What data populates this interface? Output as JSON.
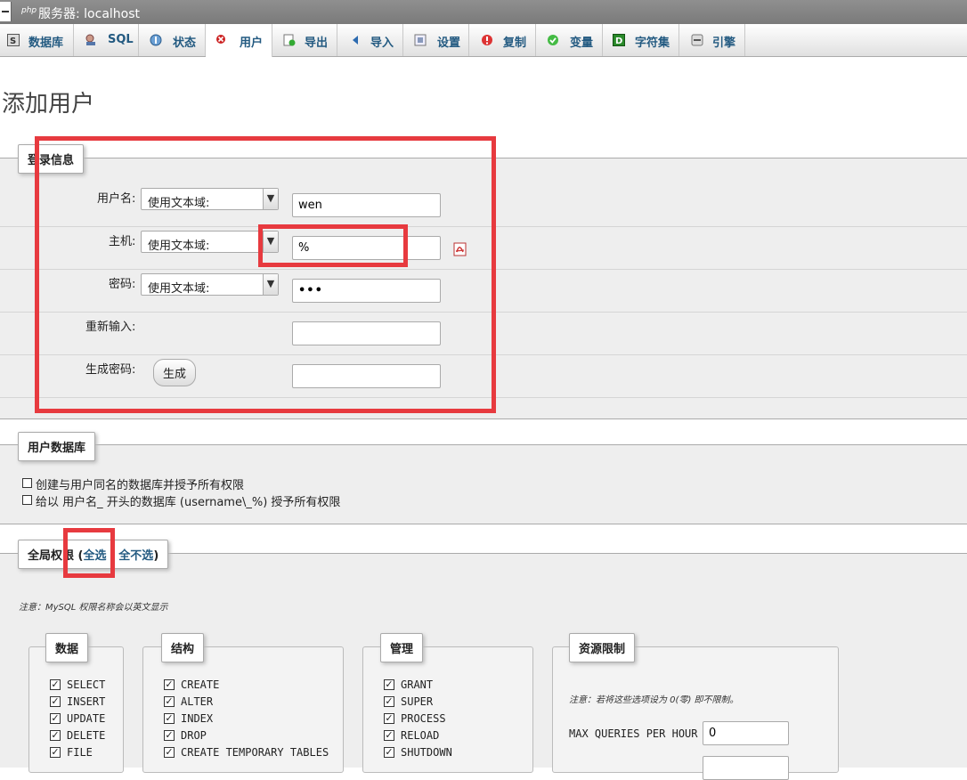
{
  "window": {
    "title": "服务器: localhost",
    "badge": "php"
  },
  "tabs": [
    {
      "label": "数据库",
      "icon": "database-icon"
    },
    {
      "label": "SQL",
      "icon": "sql-icon"
    },
    {
      "label": "状态",
      "icon": "status-icon"
    },
    {
      "label": "用户",
      "icon": "users-icon"
    },
    {
      "label": "导出",
      "icon": "export-icon"
    },
    {
      "label": "导入",
      "icon": "import-icon"
    },
    {
      "label": "设置",
      "icon": "settings-icon"
    },
    {
      "label": "复制",
      "icon": "replication-icon"
    },
    {
      "label": "变量",
      "icon": "variables-icon"
    },
    {
      "label": "字符集",
      "icon": "charset-icon"
    },
    {
      "label": "引擎",
      "icon": "engine-icon"
    }
  ],
  "page_title": "添加用户",
  "login": {
    "legend": "登录信息",
    "username_label": "用户名:",
    "username_mode": "使用文本域:",
    "username_value": "wen",
    "host_label": "主机:",
    "host_mode": "使用文本域:",
    "host_value": "%",
    "password_label": "密码:",
    "password_mode": "使用文本域:",
    "password_value": "•••",
    "retype_label": "重新输入:",
    "generate_label": "生成密码:",
    "generate_button": "生成"
  },
  "userdb": {
    "legend": "用户数据库",
    "opt1": "创建与用户同名的数据库并授予所有权限",
    "opt2": "给以 用户名_ 开头的数据库 (username\\_%) 授予所有权限"
  },
  "global": {
    "legend_prefix": "全局权限 (",
    "check_all": "全选",
    "uncheck_all": "全不选",
    "legend_suffix": ")",
    "note": "注意：MySQL 权限名称会以英文显示"
  },
  "groups": {
    "data": {
      "legend": "数据",
      "items": [
        "SELECT",
        "INSERT",
        "UPDATE",
        "DELETE",
        "FILE"
      ]
    },
    "structure": {
      "legend": "结构",
      "items": [
        "CREATE",
        "ALTER",
        "INDEX",
        "DROP",
        "CREATE TEMPORARY TABLES"
      ]
    },
    "admin": {
      "legend": "管理",
      "items": [
        "GRANT",
        "SUPER",
        "PROCESS",
        "RELOAD",
        "SHUTDOWN"
      ]
    },
    "limits": {
      "legend": "资源限制",
      "note": "注意：若将这些选项设为 0(零) 即不限制。",
      "max_queries_label": "MAX QUERIES PER HOUR",
      "max_queries_value": "0"
    }
  },
  "colors": {
    "highlight": "#e73a3f",
    "link": "#235a81"
  }
}
